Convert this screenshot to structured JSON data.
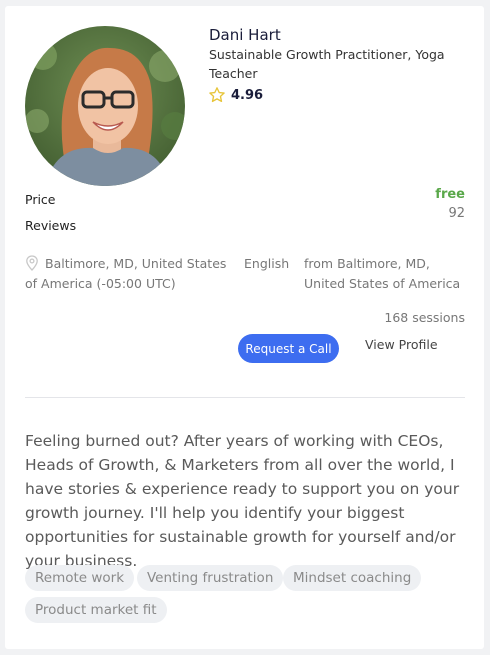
{
  "profile": {
    "name": "Dani Hart",
    "title": "Sustainable Growth Practitioner, Yoga Teacher",
    "rating": "4.96"
  },
  "stats": {
    "price_label": "Price",
    "price_value": "free",
    "reviews_label": "Reviews",
    "reviews_value": "92"
  },
  "details": {
    "location": "Baltimore, MD, United States of America (-05:00 UTC)",
    "language": "English",
    "from": "from Baltimore, MD, United States of America"
  },
  "actions": {
    "sessions": "168 sessions",
    "request_call": "Request a Call",
    "view_profile": "View Profile"
  },
  "bio": "Feeling burned out? After years of working with CEOs, Heads of Growth, & Marketers from all over the world, I have stories & experience ready to support you on your growth journey. I'll help you identify your biggest opportunities for sustainable growth for yourself and/or your business.",
  "tags": [
    "Remote work",
    "Venting frustration",
    "Mindset coaching",
    "Product market fit"
  ],
  "colors": {
    "accent": "#3d6df0",
    "price": "#5aa84a",
    "star": "#e7c53a"
  },
  "icons": {
    "rating": "star-outline-icon",
    "location": "map-pin-icon"
  }
}
